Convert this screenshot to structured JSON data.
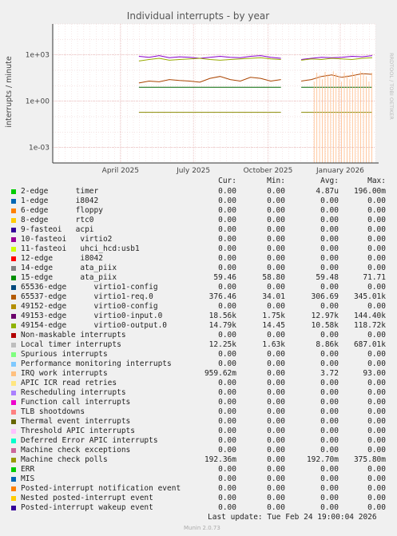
{
  "chart_data": {
    "type": "line",
    "title": "Individual interrupts - by year",
    "ylabel": "interrupts / minute",
    "side_label": "RRDTOOL / TOBI OETIKER",
    "y_scale": "log",
    "ylim": [
      0.0001,
      100000
    ],
    "y_ticks": [
      {
        "value": 0.001,
        "label": "1e-03"
      },
      {
        "value": 1,
        "label": "1e+00"
      },
      {
        "value": 1000,
        "label": "1e+03"
      }
    ],
    "x_ticks": [
      "April 2025",
      "July 2025",
      "October 2025",
      "January 2026"
    ],
    "series": [
      {
        "color": "#8800cc",
        "values": [
          800,
          700,
          900,
          650,
          750,
          700,
          600,
          700,
          800,
          700,
          650,
          800,
          900,
          700,
          600,
          null,
          500,
          600,
          700,
          650,
          700,
          800,
          750,
          900
        ]
      },
      {
        "color": "#99aa00",
        "values": [
          400,
          500,
          600,
          450,
          500,
          550,
          600,
          500,
          450,
          500,
          550,
          600,
          650,
          550,
          500,
          null,
          450,
          550,
          500,
          600,
          550,
          500,
          600,
          650
        ]
      },
      {
        "color": "#aa4400",
        "values": [
          15,
          20,
          18,
          25,
          22,
          20,
          17,
          30,
          40,
          25,
          20,
          35,
          30,
          20,
          25,
          null,
          20,
          25,
          40,
          50,
          35,
          45,
          60,
          55
        ]
      },
      {
        "color": "#006600",
        "values": [
          8,
          8,
          8,
          8,
          8,
          8,
          8,
          8,
          8,
          8,
          8,
          8,
          8,
          8,
          8,
          null,
          8,
          8,
          8,
          8,
          8,
          8,
          8,
          8
        ]
      },
      {
        "color": "#888800",
        "values": [
          0.19,
          0.19,
          0.19,
          0.19,
          0.19,
          0.19,
          0.19,
          0.19,
          0.19,
          0.19,
          0.19,
          0.19,
          0.19,
          0.19,
          0.19,
          null,
          0.19,
          0.19,
          0.19,
          0.19,
          0.19,
          0.19,
          0.19,
          0.19
        ]
      }
    ],
    "spikes": {
      "color": "#ffbb88",
      "peak": 93
    }
  },
  "legend": {
    "headers": [
      "Cur:",
      "Min:",
      "Avg:",
      "Max:"
    ],
    "rows": [
      {
        "name": "2-edge      timer",
        "color": "#00cc00",
        "cur": "0.00",
        "min": "0.00",
        "avg": "4.87u",
        "max": "196.00m"
      },
      {
        "name": "1-edge      i8042",
        "color": "#0066b3",
        "cur": "0.00",
        "min": "0.00",
        "avg": "0.00",
        "max": "0.00"
      },
      {
        "name": "6-edge      floppy",
        "color": "#ff8000",
        "cur": "0.00",
        "min": "0.00",
        "avg": "0.00",
        "max": "0.00"
      },
      {
        "name": "8-edge      rtc0",
        "color": "#ffcc00",
        "cur": "0.00",
        "min": "0.00",
        "avg": "0.00",
        "max": "0.00"
      },
      {
        "name": "9-fasteoi   acpi",
        "color": "#330099",
        "cur": "0.00",
        "min": "0.00",
        "avg": "0.00",
        "max": "0.00"
      },
      {
        "name": "10-fasteoi   virtio2",
        "color": "#990099",
        "cur": "0.00",
        "min": "0.00",
        "avg": "0.00",
        "max": "0.00"
      },
      {
        "name": "11-fasteoi   uhci_hcd:usb1",
        "color": "#ccff00",
        "cur": "0.00",
        "min": "0.00",
        "avg": "0.00",
        "max": "0.00"
      },
      {
        "name": "12-edge      i8042",
        "color": "#ff0000",
        "cur": "0.00",
        "min": "0.00",
        "avg": "0.00",
        "max": "0.00"
      },
      {
        "name": "14-edge      ata_piix",
        "color": "#808080",
        "cur": "0.00",
        "min": "0.00",
        "avg": "0.00",
        "max": "0.00"
      },
      {
        "name": "15-edge      ata_piix",
        "color": "#008f00",
        "cur": "59.46",
        "min": "58.80",
        "avg": "59.48",
        "max": "71.71"
      },
      {
        "name": "65536-edge      virtio1-config",
        "color": "#00487d",
        "cur": "0.00",
        "min": "0.00",
        "avg": "0.00",
        "max": "0.00"
      },
      {
        "name": "65537-edge      virtio1-req.0",
        "color": "#b35a00",
        "cur": "376.46",
        "min": "34.01",
        "avg": "306.69",
        "max": "345.01k"
      },
      {
        "name": "49152-edge      virtio0-config",
        "color": "#b38f00",
        "cur": "0.00",
        "min": "0.00",
        "avg": "0.00",
        "max": "0.00"
      },
      {
        "name": "49153-edge      virtio0-input.0",
        "color": "#6b006b",
        "cur": "18.56k",
        "min": "1.75k",
        "avg": "12.97k",
        "max": "144.40k"
      },
      {
        "name": "49154-edge      virtio0-output.0",
        "color": "#8fb300",
        "cur": "14.79k",
        "min": "14.45",
        "avg": "10.58k",
        "max": "118.72k"
      },
      {
        "name": "Non-maskable interrupts",
        "color": "#b30000",
        "cur": "0.00",
        "min": "0.00",
        "avg": "0.00",
        "max": "0.00"
      },
      {
        "name": "Local timer interrupts",
        "color": "#bebebe",
        "cur": "12.25k",
        "min": "1.63k",
        "avg": "8.86k",
        "max": "687.01k"
      },
      {
        "name": "Spurious interrupts",
        "color": "#80ff80",
        "cur": "0.00",
        "min": "0.00",
        "avg": "0.00",
        "max": "0.00"
      },
      {
        "name": "Performance monitoring interrupts",
        "color": "#80c9ff",
        "cur": "0.00",
        "min": "0.00",
        "avg": "0.00",
        "max": "0.00"
      },
      {
        "name": "IRQ work interrupts",
        "color": "#ffc080",
        "cur": "959.62m",
        "min": "0.00",
        "avg": "3.72",
        "max": "93.00"
      },
      {
        "name": "APIC ICR read retries",
        "color": "#ffe680",
        "cur": "0.00",
        "min": "0.00",
        "avg": "0.00",
        "max": "0.00"
      },
      {
        "name": "Rescheduling interrupts",
        "color": "#aa80ff",
        "cur": "0.00",
        "min": "0.00",
        "avg": "0.00",
        "max": "0.00"
      },
      {
        "name": "Function call interrupts",
        "color": "#ee00cc",
        "cur": "0.00",
        "min": "0.00",
        "avg": "0.00",
        "max": "0.00"
      },
      {
        "name": "TLB shootdowns",
        "color": "#ff8080",
        "cur": "0.00",
        "min": "0.00",
        "avg": "0.00",
        "max": "0.00"
      },
      {
        "name": "Thermal event interrupts",
        "color": "#666600",
        "cur": "0.00",
        "min": "0.00",
        "avg": "0.00",
        "max": "0.00"
      },
      {
        "name": "Threshold APIC interrupts",
        "color": "#ffbfff",
        "cur": "0.00",
        "min": "0.00",
        "avg": "0.00",
        "max": "0.00"
      },
      {
        "name": "Deferred Error APIC interrupts",
        "color": "#00ffcc",
        "cur": "0.00",
        "min": "0.00",
        "avg": "0.00",
        "max": "0.00"
      },
      {
        "name": "Machine check exceptions",
        "color": "#cc6699",
        "cur": "0.00",
        "min": "0.00",
        "avg": "0.00",
        "max": "0.00"
      },
      {
        "name": "Machine check polls",
        "color": "#999900",
        "cur": "192.36m",
        "min": "0.00",
        "avg": "192.70m",
        "max": "375.80m"
      },
      {
        "name": "ERR",
        "color": "#00cc00",
        "cur": "0.00",
        "min": "0.00",
        "avg": "0.00",
        "max": "0.00"
      },
      {
        "name": "MIS",
        "color": "#0066b3",
        "cur": "0.00",
        "min": "0.00",
        "avg": "0.00",
        "max": "0.00"
      },
      {
        "name": "Posted-interrupt notification event",
        "color": "#ff8000",
        "cur": "0.00",
        "min": "0.00",
        "avg": "0.00",
        "max": "0.00"
      },
      {
        "name": "Nested posted-interrupt event",
        "color": "#ffcc00",
        "cur": "0.00",
        "min": "0.00",
        "avg": "0.00",
        "max": "0.00"
      },
      {
        "name": "Posted-interrupt wakeup event",
        "color": "#330099",
        "cur": "0.00",
        "min": "0.00",
        "avg": "0.00",
        "max": "0.00"
      }
    ]
  },
  "footer": {
    "last_update": "Last update: Tue Feb 24 19:00:04 2026",
    "generator": "Munin 2.0.73"
  }
}
